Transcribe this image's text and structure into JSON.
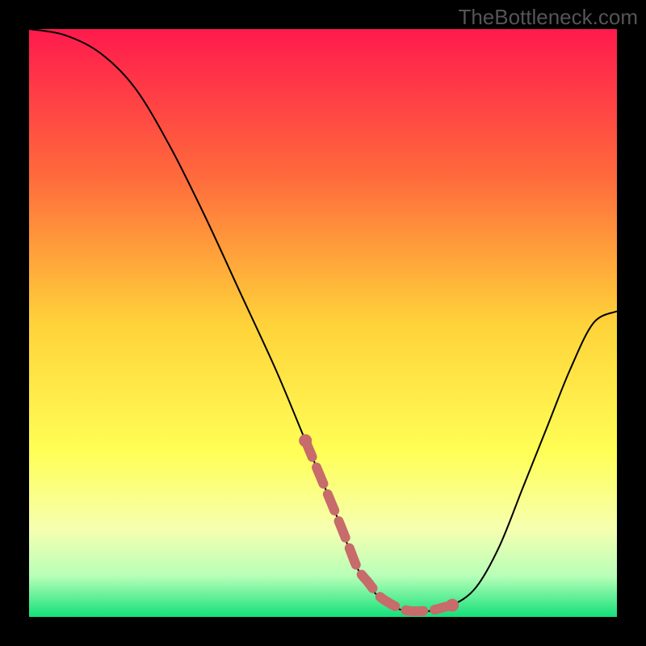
{
  "watermark": "TheBottleneck.com",
  "chart_data": {
    "type": "line",
    "title": "",
    "xlabel": "",
    "ylabel": "",
    "xlim": [
      0,
      100
    ],
    "ylim": [
      0,
      100
    ],
    "series": [
      {
        "name": "bottleneck-curve",
        "x": [
          0,
          6,
          12,
          18,
          24,
          30,
          36,
          42,
          47,
          52,
          56,
          60,
          64,
          68,
          72,
          76,
          80,
          84,
          88,
          92,
          96,
          100
        ],
        "y": [
          100,
          99,
          96,
          90,
          80,
          68,
          55,
          42,
          30,
          18,
          8,
          3,
          1,
          1,
          2,
          5,
          12,
          22,
          32,
          42,
          50,
          52
        ]
      }
    ],
    "highlight_band": {
      "name": "flat-bottom-highlight",
      "x_range": [
        47,
        72
      ],
      "color": "#c76b6b"
    },
    "gradient_stops": [
      {
        "pct": 0,
        "color": "#ff1a4d"
      },
      {
        "pct": 25,
        "color": "#ff6a3c"
      },
      {
        "pct": 50,
        "color": "#ffd23a"
      },
      {
        "pct": 72,
        "color": "#ffff56"
      },
      {
        "pct": 85,
        "color": "#f6ffb0"
      },
      {
        "pct": 93,
        "color": "#b8ffb8"
      },
      {
        "pct": 100,
        "color": "#13e07a"
      }
    ]
  }
}
